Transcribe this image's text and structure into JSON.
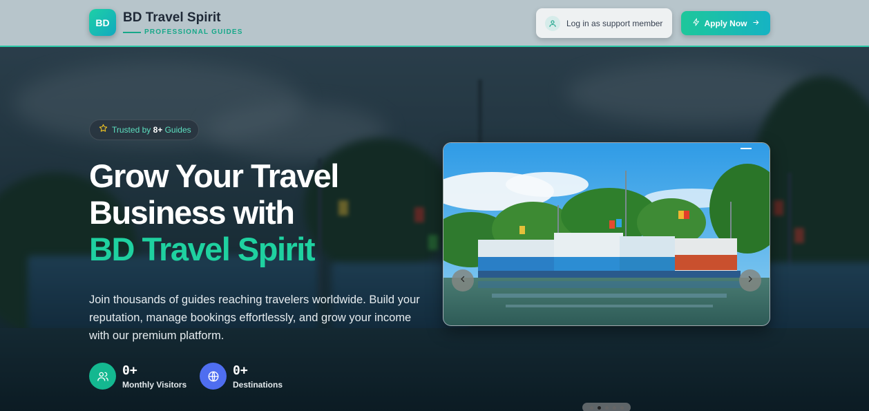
{
  "header": {
    "logo_text": "BD",
    "brand_title": "BD Travel Spirit",
    "brand_subtitle": "PROFESSIONAL GUIDES",
    "login_label": "Log in as support member",
    "apply_label": "Apply Now"
  },
  "hero": {
    "trust_prefix": "Trusted by ",
    "trust_count": "8+",
    "trust_suffix": " Guides",
    "title_line1": "Grow Your Travel",
    "title_line2": "Business with",
    "title_accent": "BD Travel Spirit",
    "description": "Join thousands of guides reaching travelers worldwide. Build your reputation, manage bookings effortlessly, and grow your income with our premium platform.",
    "stats": [
      {
        "value": "0+",
        "label": "Monthly Visitors",
        "icon": "users-icon",
        "color": "#14b890"
      },
      {
        "value": "0+",
        "label": "Destinations",
        "icon": "globe-icon",
        "color": "#4f6ef0"
      }
    ]
  },
  "carousel": {
    "slide_count": 5,
    "active_slide": 2
  },
  "colors": {
    "accent": "#1fd1a0",
    "header_bg": "#c3d0d6",
    "apply_gradient_start": "#1ec79b",
    "apply_gradient_end": "#16b3c3"
  }
}
